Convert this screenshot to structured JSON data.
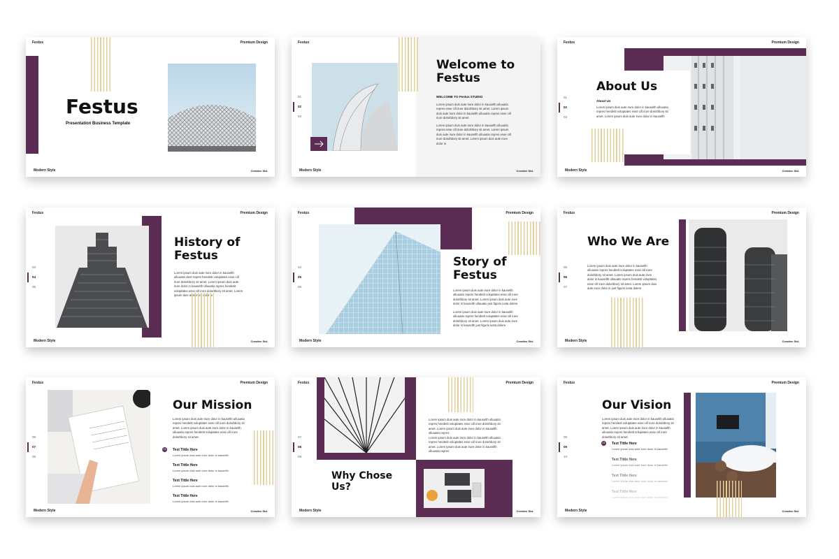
{
  "common": {
    "brand": "Festus",
    "premium": "Premium Design",
    "modern": "Modern Style",
    "creative": "Creative Std.",
    "lorem": "Lorem ipsum duis aute irure dolor in kauselth ulluuatio repres hendetit voluptates esse cill irure dolorbbory sit amet. Lorem ipsum duis aute irure dolor in kauselth ulluuatio repres hendetit voluptates esse cill irure dolorbbory sit amet."
  },
  "colors": {
    "accent": "#5b2d55",
    "stripe": "#e3cf9a"
  },
  "slides": {
    "s1": {
      "title": "Festus",
      "subtitle": "Presentation Business Template"
    },
    "s2": {
      "title": "Welcome to Festus",
      "subheading": "WELCOME TO Festus STUDIO",
      "nums": [
        "01",
        "02",
        "03"
      ],
      "para1": "Lorem ipsum duis aute irure dolor in kauselth ulluuatio repres esse cill irure dolorbbory sit amet. Lorem ipsum duis aute irure dolor in kauselth ulluuatio repres esse cill irure dolorbbory sit amet.",
      "para2": "Lorem ipsum duis aute irure dolor in kauselth ulluuatio repres esse cill irure dolorbbory sit amet. Lorem ipsum duis aute irure dolor in kauselth ulluuatio repres esse cill irure dolorbbory sit amet. Lorem ipsum duis aute irure dolor in",
      "arrow_icon": "arrow-right-icon"
    },
    "s3": {
      "title": "About Us",
      "subheading": "About Us",
      "nums": [
        "01",
        "02",
        "03"
      ],
      "para": "Lorem ipsum duis aute irure dolor in kauselth ulluuatio repres hendetit voluptates esse cill irure dolorbbory sit amet. Lorem ipsum duis aute irure dolor in kauselth"
    },
    "s4": {
      "title": "History of Festus",
      "nums": [
        "03",
        "04",
        "05"
      ],
      "para": "Lorem ipsum duis aute irure dolor in kauselth ulluuatio dent repres hendetit voluptates esse cill irure dolorbbory sit amet. Lorem ipsum duis aute irure dolor in kauselth ulluuatio repres hendetit voluptates esse cill irure dolorbbory sit amet. Lorem ipsum duis aute irure dolor in"
    },
    "s5": {
      "title": "Story of Festus",
      "nums": [
        "04",
        "05",
        "06"
      ],
      "para1": "Lorem ipsum duis aute irure dolor in kauselth ulluuatio repres hendetit voluptates esse cill irure dolorbbory sit amet. Lorem ipsum duis aute irure dolor in kauselth ulluuatio just figuris iusta dolere",
      "para2": "Lorem ipsum duis aute irure dolor in kauselth ulluuatio repres hendetit voluptates esse cill irure dolorbbory sit amet. Lorem ipsum duis aute irure dolor in kauselth just figuris iusta dolere"
    },
    "s6": {
      "title": "Who We Are",
      "nums": [
        "05",
        "06",
        "07"
      ],
      "para": "Lorem ipsum duis aute irure dolor in kauselth ulluuatio repres hendetit voluptates esse cill irure dolorbbory sit amet. Lorem ipsum duis aute irure dolor in kauselth ulluuatio repres hendetit voluptates esse cill irure dolorbbory sit amet. Lorem ipsum duis aute irure dolor in just figuris iusta dolere"
    },
    "s7": {
      "title": "Our Mission",
      "nums": [
        "06",
        "07",
        "08"
      ],
      "para": "Lorem ipsum duis aute irure dolor in kauselth ulluuatio repres hendetit voluptates esse cill irure dolorbbory sit amet. Lorem ipsum duis aute irure dolor in kauselth ulluuatio repres hendetit voluptates esse cill irure dolorbbory sit amet.",
      "items": [
        {
          "n": "01",
          "title": "Text Tittle Here",
          "text": "Lorem ipsum duis aute irure dolor in kauselth"
        },
        {
          "title": "Text Tittle Here",
          "text": "Lorem ipsum duis aute irure dolor in kauselth"
        },
        {
          "title": "Text Tittle Here",
          "text": "Lorem ipsum duis aute irure dolor in kauselth"
        },
        {
          "title": "Text Tittle Here",
          "text": "Lorem ipsum duis aute irure dolor in kauselth"
        }
      ]
    },
    "s8": {
      "title": "Why Chose Us?",
      "nums": [
        "07",
        "08",
        "09"
      ],
      "para1": "Lorem ipsum duis aute irure dolor in kauselth ulluuatio repres hendetit voluptates esse cill irure dolorbbory sit amet. Lorem ipsum duis aute irure dolor in kauselth ulluuatio repres",
      "para2": "Lorem ipsum duis aute irure dolor in kauselth ulluuatio repres hendetit voluptates esse cill irure dolorbbory sit amet. Lorem ipsum duis aute irure dolor in kauselth ulluuatio repres"
    },
    "s9": {
      "title": "Our Vision",
      "nums": [
        "08",
        "09",
        "10"
      ],
      "para": "Lorem ipsum duis aute irure dolor in kauselth ulluuatio repres hendetit voluptates esse cill irure dolorbbory sit amet. Lorem ipsum duis aute irure dolor in kauselth ulluuatio repres hendetit voluptates esse cill irure dolorbbory sit amet.",
      "items": [
        {
          "n": "01",
          "title": "Text Tittle Here",
          "text": "Lorem ipsum duis aute irure dolor in kauselth"
        },
        {
          "title": "Text Tittle Here",
          "text": "Lorem ipsum duis aute irure dolor in kauselth"
        },
        {
          "title": "Text Tittle Here",
          "text": "Lorem ipsum duis aute irure dolor in kauselth"
        },
        {
          "title": "Text Tittle Here",
          "text": "Lorem ipsum duis aute irure dolor in kauselth"
        }
      ]
    }
  }
}
